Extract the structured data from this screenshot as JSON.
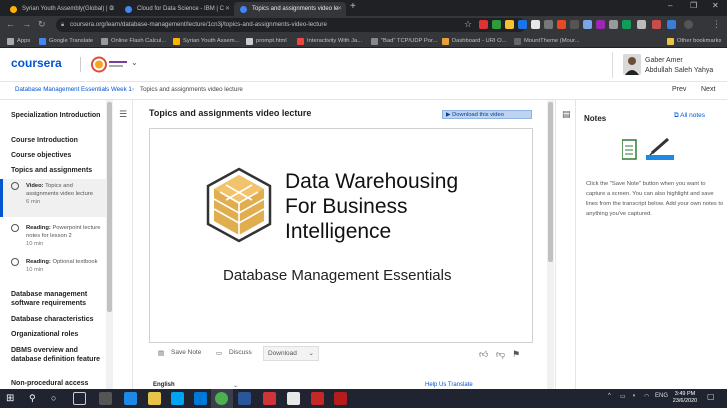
{
  "browser": {
    "tabs": [
      {
        "title": "Syrian Youth Assembly(Global) | C",
        "color": "#ffb300"
      },
      {
        "title": "Cloud for Data Science - IBM | C",
        "color": "#4285f4"
      },
      {
        "title": "Topics and assignments video le",
        "color": "#4285f4"
      }
    ],
    "url": "coursera.org/learn/database-management/lecture/1cn3j/topics-and-assignments-video-lecture",
    "bookmarks": [
      {
        "label": "Apps",
        "color": "#aaa"
      },
      {
        "label": "Google Translate",
        "color": "#4285f4"
      },
      {
        "label": "Online Flash Calcul...",
        "color": "#999"
      },
      {
        "label": "Syrian Youth Assem...",
        "color": "#ffb300"
      },
      {
        "label": "prompt.html",
        "color": "#ccc"
      },
      {
        "label": "Interactivity With Ja...",
        "color": "#e44"
      },
      {
        "label": "\"Bad\" TCP/UDP Por...",
        "color": "#888"
      },
      {
        "label": "Dashboard - URI O...",
        "color": "#e8a03a"
      },
      {
        "label": "MountTheme (Mour...",
        "color": "#666"
      },
      {
        "label": "Other bookmarks",
        "color": "#e8c34a"
      }
    ]
  },
  "header": {
    "logo": "coursera",
    "user_line1": "Gaber Amer",
    "user_line2": "Abdullah Saleh Yahya"
  },
  "breadcrumb": {
    "course": "Database Management Essentials",
    "week": "Week 1",
    "current": "Topics and assignments video lecture",
    "prev": "Prev",
    "next": "Next"
  },
  "sidebar": {
    "items": [
      "Specialization Introduction",
      "Course Introduction",
      "Course objectives",
      "Topics and assignments"
    ],
    "subitems": [
      {
        "type": "Video:",
        "title": "Topics and assignments video lecture",
        "duration": "6 min"
      },
      {
        "type": "Reading:",
        "title": "Powerpoint lecture notes for lesson 2",
        "duration": "10 min"
      },
      {
        "type": "Reading:",
        "title": "Optional textbook",
        "duration": "10 min"
      }
    ],
    "items2": [
      "Database management software requirements",
      "Database characteristics",
      "Organizational roles",
      "DBMS overview and database definition feature",
      "Non-procedural access"
    ]
  },
  "main": {
    "title": "Topics and assignments video lecture",
    "download_label": "Download this video",
    "video_heading_1": "Data Warehousing",
    "video_heading_2": "For Business",
    "video_heading_3": "Intelligence",
    "video_subtitle": "Database Management Essentials",
    "save_note": "Save Note",
    "discuss": "Discuss",
    "download": "Download",
    "transcript_lang": "English",
    "help_translate": "Help Us Translate"
  },
  "notes": {
    "title": "Notes",
    "all_notes": "All notes",
    "body": "Click the \"Save Note\" button when you want to capture a screen. You can also highlight and save lines from the transcript below. Add your own notes to anything you've captured."
  },
  "taskbar": {
    "lang": "ENG",
    "time": "3:49 PM",
    "date": "23/6/2020"
  }
}
